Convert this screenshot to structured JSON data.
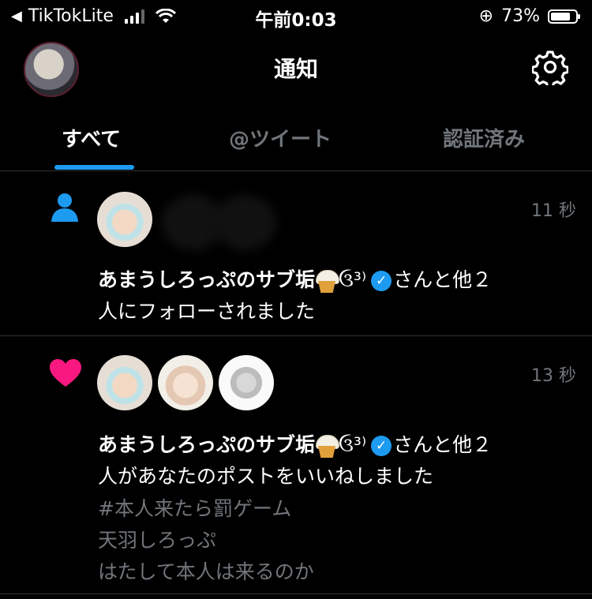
{
  "status_bar": {
    "back_arrow": "◀",
    "app": "TikTokLite",
    "time": "午前0:03",
    "lock_icon": "⊕",
    "battery": "73%"
  },
  "header": {
    "title": "通知"
  },
  "tabs": [
    {
      "label": "すべて",
      "active": true
    },
    {
      "label": "@ツイート",
      "active": false
    },
    {
      "label": "認証済み",
      "active": false
    }
  ],
  "notifications": [
    {
      "kind": "follow",
      "time": "11 秒",
      "user_name": "あまうしろっぷのサブ垢",
      "emoji_suffix": "ઉ³⁾",
      "verified_glyph": "✓",
      "line1_rest": "さんと他２",
      "line2": "人にフォローされました"
    },
    {
      "kind": "like",
      "time": "13 秒",
      "user_name": "あまうしろっぷのサブ垢",
      "emoji_suffix": "ઉ³⁾",
      "verified_glyph": "✓",
      "line1_rest": "さんと他２",
      "line2": "人があなたのポストをいいねしました",
      "tweet_lines": [
        "#本人来たら罰ゲーム",
        "天羽しろっぷ",
        "はたして本人は来るのか"
      ]
    }
  ],
  "colors": {
    "accent": "#1d9bf0",
    "like": "#f91880",
    "muted": "#71767b"
  }
}
